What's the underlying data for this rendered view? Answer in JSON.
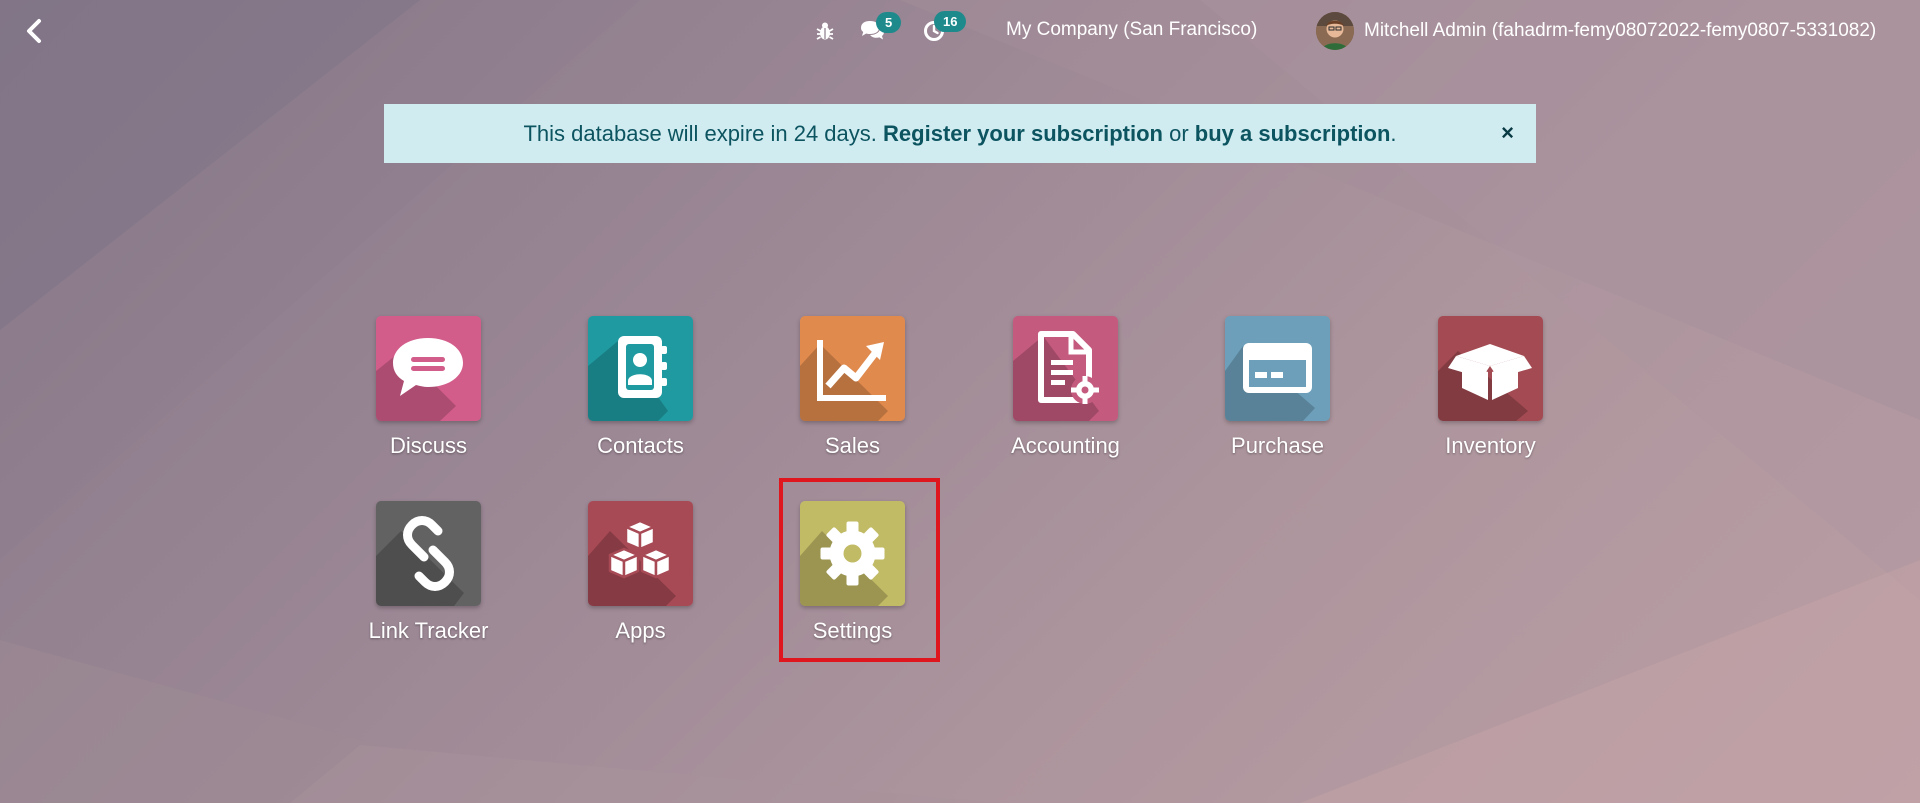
{
  "topbar": {
    "back_icon": "chevron-left-icon",
    "debug_icon": "bug-icon",
    "messages_icon": "chat-bubbles-icon",
    "messages_count": "5",
    "activities_icon": "clock-icon",
    "activities_count": "16",
    "company": "My Company (San Francisco)",
    "user_name": "Mitchell Admin (fahadrm-femy08072022-femy0807-5331082)"
  },
  "banner": {
    "text_before": "This database will expire in 24 days.",
    "register_link": "Register your subscription",
    "or_text": "or",
    "buy_link": "buy a subscription",
    "period": ".",
    "close": "×"
  },
  "apps": [
    {
      "label": "Discuss",
      "icon": "speech-bubble-icon",
      "color": "#d35d8a"
    },
    {
      "label": "Contacts",
      "icon": "address-book-icon",
      "color": "#1f9aa0"
    },
    {
      "label": "Sales",
      "icon": "trend-chart-icon",
      "color": "#e08a4e"
    },
    {
      "label": "Accounting",
      "icon": "document-gear-icon",
      "color": "#c45a7e"
    },
    {
      "label": "Purchase",
      "icon": "credit-card-icon",
      "color": "#6d9fba"
    },
    {
      "label": "Inventory",
      "icon": "open-box-icon",
      "color": "#a34a52"
    },
    {
      "label": "Link Tracker",
      "icon": "chain-link-icon",
      "color": "#626262"
    },
    {
      "label": "Apps",
      "icon": "cubes-icon",
      "color": "#a84a55"
    },
    {
      "label": "Settings",
      "icon": "gear-icon",
      "color": "#c2bb66"
    }
  ],
  "highlight_color": "#e0161e"
}
